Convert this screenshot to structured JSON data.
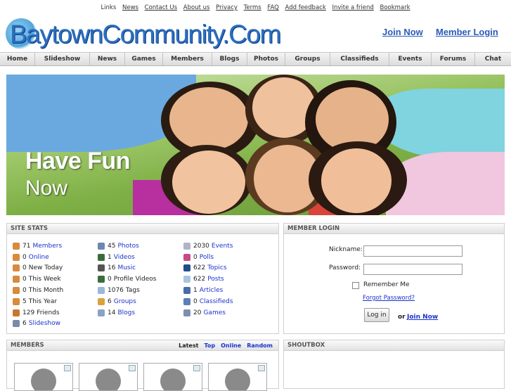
{
  "toplinks": [
    "Links",
    "News",
    "Contact Us",
    "About us",
    "Privacy",
    "Terms",
    "FAQ",
    "Add feedback",
    "Invite a friend",
    "Bookmark"
  ],
  "logo": {
    "text": "BaytownCommunity.Com"
  },
  "header": {
    "join": "Join Now",
    "login": "Member Login"
  },
  "nav": [
    "Home",
    "Slideshow",
    "News",
    "Games",
    "Members",
    "Blogs",
    "Photos",
    "Groups",
    "Classifieds",
    "Events",
    "Forums",
    "Chat"
  ],
  "banner": {
    "title": "Have Fun",
    "subtitle": "Now"
  },
  "site_stats": {
    "title": "SITE STATS",
    "col1": [
      {
        "count": "71",
        "label": "Members",
        "link": true,
        "icon": "member-icon"
      },
      {
        "count": "0",
        "label": "Online",
        "link": true,
        "icon": "member-icon"
      },
      {
        "count": "0",
        "label": "New Today",
        "link": false,
        "icon": "member-icon"
      },
      {
        "count": "0",
        "label": "This Week",
        "link": false,
        "icon": "member-icon"
      },
      {
        "count": "0",
        "label": "This Month",
        "link": false,
        "icon": "member-icon"
      },
      {
        "count": "5",
        "label": "This Year",
        "link": false,
        "icon": "member-icon"
      },
      {
        "count": "129",
        "label": "Friends",
        "link": false,
        "icon": "friends-icon"
      },
      {
        "count": "6",
        "label": "Slideshow",
        "link": true,
        "icon": "slideshow-icon"
      }
    ],
    "col2": [
      {
        "count": "45",
        "label": "Photos",
        "link": true,
        "icon": "photo-icon"
      },
      {
        "count": "1",
        "label": "Videos",
        "link": true,
        "icon": "video-icon"
      },
      {
        "count": "16",
        "label": "Music",
        "link": true,
        "icon": "music-icon"
      },
      {
        "count": "0",
        "label": "Profile Videos",
        "link": false,
        "icon": "video-icon"
      },
      {
        "count": "1076",
        "label": "Tags",
        "link": false,
        "icon": "tag-icon"
      },
      {
        "count": "6",
        "label": "Groups",
        "link": true,
        "icon": "groups-icon"
      },
      {
        "count": "14",
        "label": "Blogs",
        "link": true,
        "icon": "blog-icon"
      }
    ],
    "col3": [
      {
        "count": "2030",
        "label": "Events",
        "link": true,
        "icon": "calendar-icon"
      },
      {
        "count": "0",
        "label": "Polls",
        "link": true,
        "icon": "poll-icon"
      },
      {
        "count": "622",
        "label": "Topics",
        "link": true,
        "icon": "topic-icon"
      },
      {
        "count": "622",
        "label": "Posts",
        "link": true,
        "icon": "post-icon"
      },
      {
        "count": "1",
        "label": "Articles",
        "link": true,
        "icon": "article-icon"
      },
      {
        "count": "0",
        "label": "Classifieds",
        "link": true,
        "icon": "car-icon"
      },
      {
        "count": "20",
        "label": "Games",
        "link": true,
        "icon": "games-icon"
      }
    ]
  },
  "member_login": {
    "title": "MEMBER LOGIN",
    "nickname_label": "Nickname:",
    "password_label": "Password:",
    "remember": "Remember Me",
    "forgot": "Forgot Password?",
    "login_button": "Log in",
    "or": "or",
    "join": "Join Now"
  },
  "members": {
    "title": "MEMBERS",
    "tabs": [
      "Latest",
      "Top",
      "Online",
      "Random"
    ]
  },
  "shoutbox": {
    "title": "SHOUTBOX"
  },
  "colors": {
    "link": "#1a33cc",
    "brand": "#2b6fc0",
    "panel_header": "#e2e2e2"
  }
}
